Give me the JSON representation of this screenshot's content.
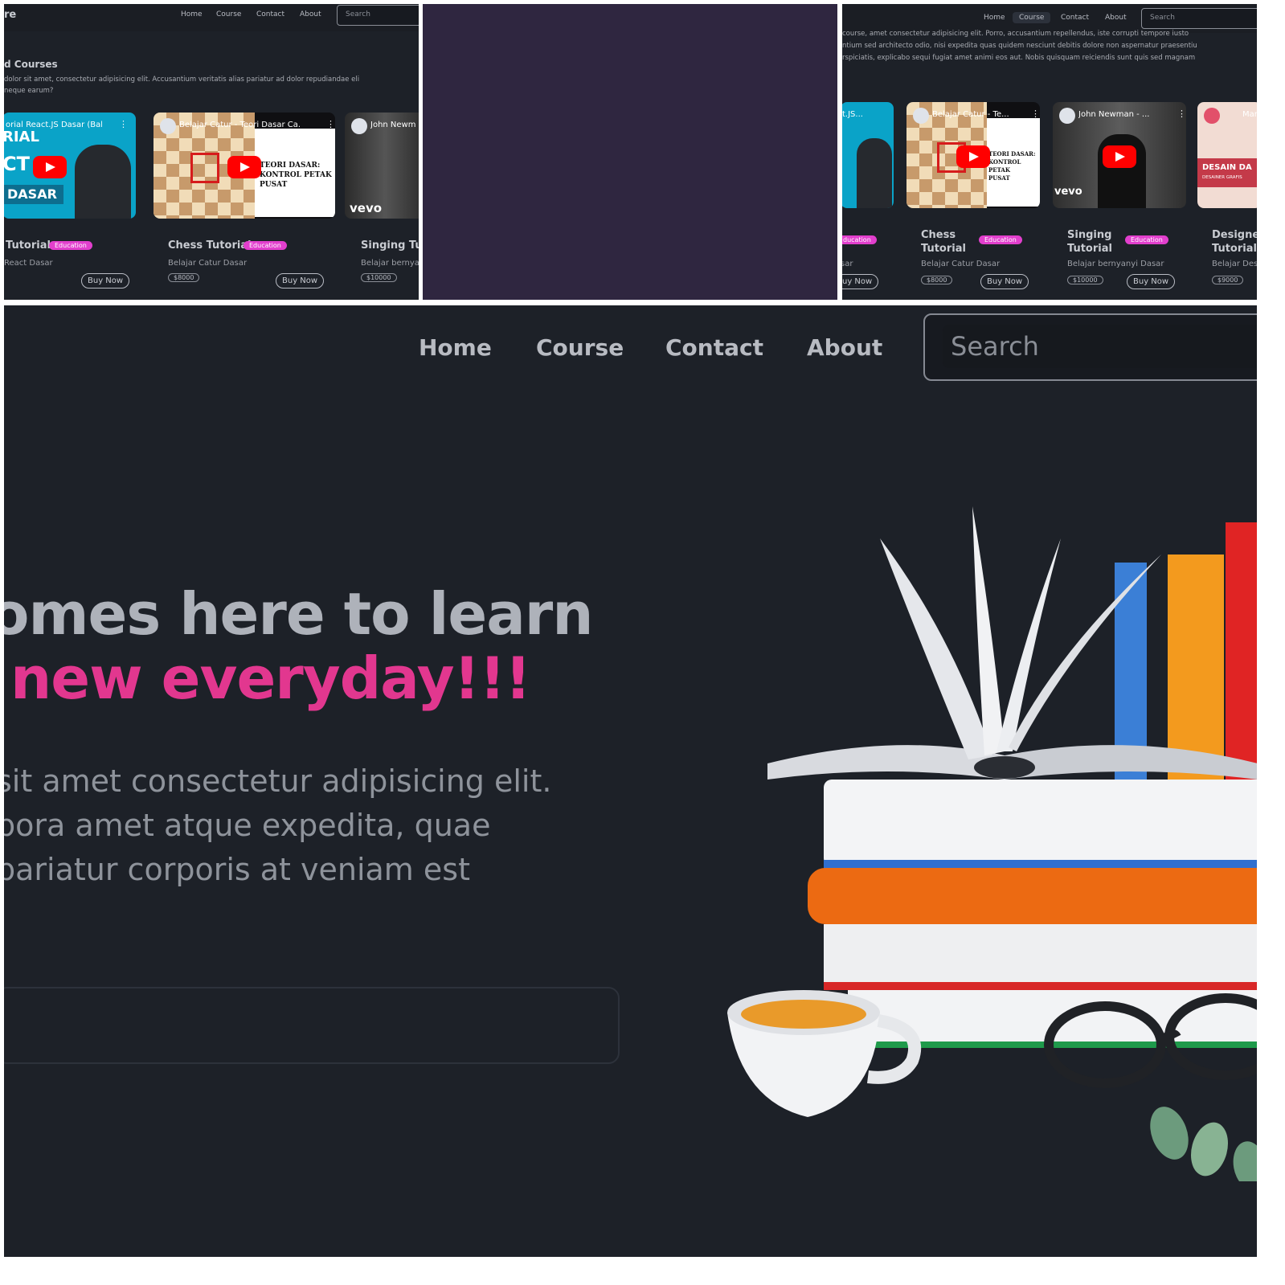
{
  "nav": {
    "home": "Home",
    "course": "Course",
    "contact": "Contact",
    "about": "About",
    "search_placeholder": "Search"
  },
  "panel1": {
    "logo_fragment": "re",
    "section_title": "d Courses",
    "section_desc_1": "dolor sit amet, consectetur adipisicing elit. Accusantium veritatis alias pariatur ad dolor repudiandae eli",
    "section_desc_2": "neque earum?",
    "cards": [
      {
        "thumb_title": "orial React.JS Dasar (Bah...",
        "title": "Tutorial",
        "badge": "Education",
        "desc": "React Dasar",
        "price": "",
        "buy": "Buy Now",
        "thumb_text_1": "RIAL",
        "thumb_text_2": "CT",
        "thumb_text_3": "DASAR"
      },
      {
        "thumb_title": "Belajar Catur - Teori Dasar Ca...",
        "title": "Chess Tutorial",
        "badge": "Education",
        "desc": "Belajar Catur Dasar",
        "price": "$8000",
        "buy": "Buy Now",
        "thumb_text": "TEORI DASAR:\nKONTROL PETAK\nPUSAT"
      },
      {
        "thumb_title": "John Newm",
        "title": "Singing Tut",
        "desc": "Belajar bernya",
        "price": "$10000",
        "vevo": "vevo"
      }
    ]
  },
  "panel3": {
    "desc_1": "course, amet consectetur adipisicing elit. Porro, accusantium repellendus, iste corrupti tempore iusto",
    "desc_2": "ntium sed architecto odio, nisi expedita quas quidem nesciunt debitis dolore non aspernatur praesentiu",
    "desc_3": "rspiciatis, explicabo sequi fugiat amet animi eos aut. Nobis quisquam reiciendis sunt quis sed magnam",
    "cards": [
      {
        "thumb_title": "t.JS...",
        "badge": "ducation",
        "desc": "sar",
        "buy": "uy Now"
      },
      {
        "thumb_title": "Belajar Catur - Te...",
        "title_1": "Chess",
        "title_2": "Tutorial",
        "badge": "Education",
        "desc": "Belajar Catur Dasar",
        "price": "$8000",
        "buy": "Buy Now",
        "thumb_text": "TEORI DASAR:\nKONTROL PETAK\nPUSAT"
      },
      {
        "thumb_title": "John Newman - ...",
        "title_1": "Singing",
        "title_2": "Tutorial",
        "badge": "Education",
        "desc": "Belajar bernyanyi Dasar",
        "price": "$10000",
        "buy": "Buy Now",
        "vevo": "vevo"
      },
      {
        "thumb_title": "Mar",
        "title_1": "Designer",
        "title_2": "Tutorial",
        "desc": "Belajar Des",
        "price": "$9000",
        "thumb_text": "DESAIN DA",
        "thumb_sub": "DESAINER GRAFIS"
      }
    ]
  },
  "hero": {
    "line1": "omes here to learn",
    "line2": "new everyday!!!",
    "p1": "sit amet consectetur adipisicing elit.",
    "p2": "pora amet atque expedita, quae",
    "p3": "pariatur corporis at veniam est"
  },
  "colors": {
    "background": "#1d2128",
    "accent_pink": "#e2378f",
    "badge_magenta": "#e23fcd",
    "youtube_red": "#ff0000",
    "transition_purple": "#2f2640"
  },
  "icons": [
    "play-icon",
    "more-vert-icon",
    "avatar-icon",
    "books-illustration"
  ]
}
